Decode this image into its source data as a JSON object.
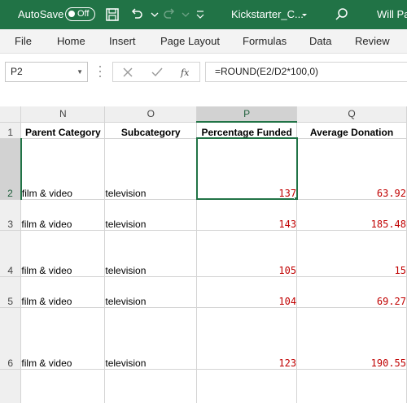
{
  "titlebar": {
    "autosave_label": "AutoSave",
    "autosave_state": "Off",
    "document_title": "Kickstarter_C...",
    "user_name": "Will Par"
  },
  "ribbon": {
    "tabs": [
      "File",
      "Home",
      "Insert",
      "Page Layout",
      "Formulas",
      "Data",
      "Review"
    ]
  },
  "formula_bar": {
    "name_box": "P2",
    "formula": "=ROUND(E2/D2*100,0)",
    "fx_label": "fx"
  },
  "grid": {
    "columns": [
      "N",
      "O",
      "P",
      "Q"
    ],
    "selected_column": "P",
    "selected_row": "2",
    "header_row": {
      "row": "1",
      "cells": [
        "Parent Category",
        "Subcategory",
        "Percentage Funded",
        "Average Donation"
      ]
    },
    "rows": [
      {
        "row": "2",
        "parent": "film & video",
        "sub": "television",
        "pct": "137",
        "avg": "63.92"
      },
      {
        "row": "3",
        "parent": "film & video",
        "sub": "television",
        "pct": "143",
        "avg": "185.48"
      },
      {
        "row": "4",
        "parent": "film & video",
        "sub": "television",
        "pct": "105",
        "avg": "15"
      },
      {
        "row": "5",
        "parent": "film & video",
        "sub": "television",
        "pct": "104",
        "avg": "69.27"
      },
      {
        "row": "6",
        "parent": "film & video",
        "sub": "television",
        "pct": "123",
        "avg": "190.55"
      },
      {
        "row": "",
        "parent": "",
        "sub": "",
        "pct": "",
        "avg": ""
      }
    ]
  },
  "colors": {
    "accent": "#217346",
    "number_text": "#c00000"
  }
}
